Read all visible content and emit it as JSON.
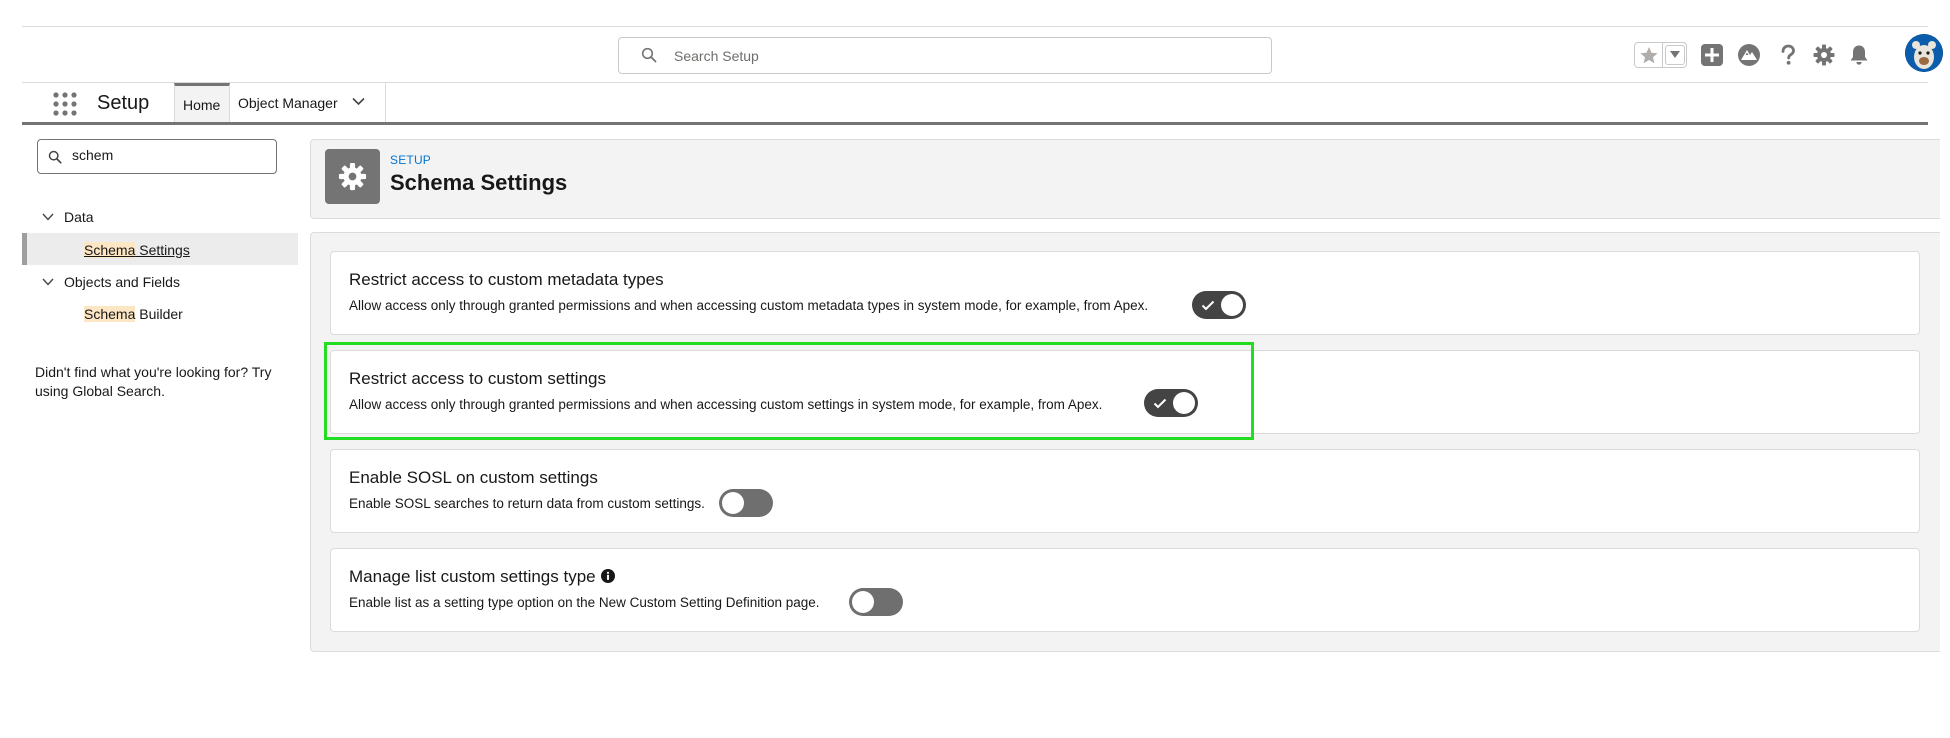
{
  "header": {
    "search_placeholder": "Search Setup",
    "icons": [
      "star-icon",
      "chevron-down-icon",
      "add-icon",
      "trailhead-icon",
      "help-icon",
      "gear-icon",
      "bell-icon",
      "avatar"
    ]
  },
  "appbar": {
    "app_name": "Setup",
    "tabs": [
      {
        "label": "Home"
      },
      {
        "label": "Object Manager"
      }
    ]
  },
  "sidebar": {
    "quick_find_value": "schem",
    "tree": [
      {
        "label": "Data",
        "children": [
          {
            "match": "Schema",
            "rest": " Settings"
          }
        ]
      },
      {
        "label": "Objects and Fields",
        "children": [
          {
            "match": "Schema",
            "rest": " Builder"
          }
        ]
      }
    ],
    "not_found_text": "Didn't find what you're looking for? Try using Global Search."
  },
  "page_header": {
    "eyebrow": "SETUP",
    "title": "Schema Settings"
  },
  "settings": [
    {
      "title": "Restrict access to custom metadata types",
      "description": "Allow access only through granted permissions and when accessing custom metadata types in system mode, for example, from Apex.",
      "enabled": true
    },
    {
      "title": "Restrict access to custom settings",
      "description": "Allow access only through granted permissions and when accessing custom settings in system mode, for example, from Apex.",
      "enabled": true
    },
    {
      "title": "Enable SOSL on custom settings",
      "description": "Enable SOSL searches to return data from custom settings.",
      "enabled": false
    },
    {
      "title": "Manage list custom settings type",
      "description": "Enable list as a setting type option on the New Custom Setting Definition page.",
      "enabled": false,
      "has_info_icon": true
    }
  ],
  "colors": {
    "brand_blue": "#0176d3",
    "toggle_on": "#444444",
    "toggle_off": "#6f6f6f",
    "highlight_match": "#fde6c4",
    "focus_outline": "#22dd22"
  }
}
